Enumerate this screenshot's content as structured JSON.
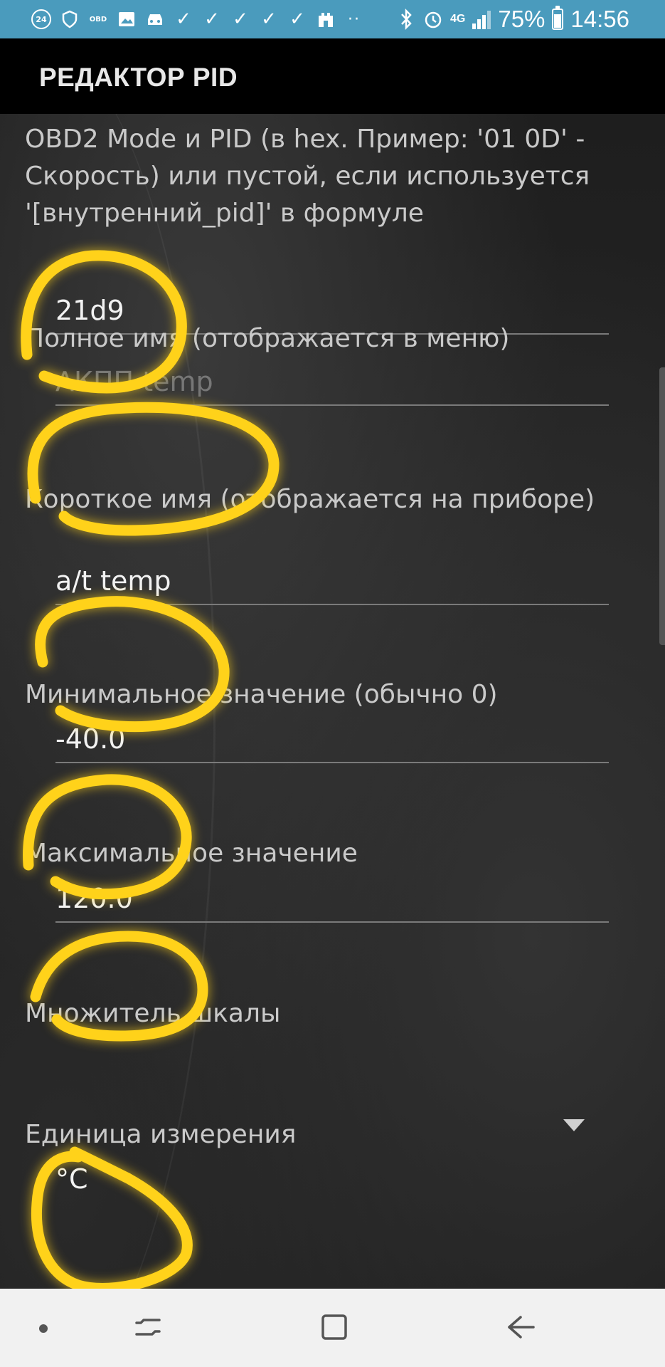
{
  "status_bar": {
    "notification_icons": [
      "calendar-24-icon",
      "shield-icon",
      "obd-icon",
      "gallery-icon",
      "car-icon",
      "check-icon",
      "check-icon",
      "check-icon",
      "check-icon",
      "check-icon",
      "castle-icon",
      "more-dots-icon"
    ],
    "calendar_day": "24",
    "obd_label": "OBD",
    "network_type": "4G",
    "battery_level": "75%",
    "battery_fraction": 0.75,
    "time": "14:56"
  },
  "app_bar": {
    "title": "РЕДАКТОР PID"
  },
  "form": {
    "mode_pid": {
      "label": "OBD2 Mode и PID (в hex. Пример: '01 0D' - Скорость) или пустой, если используется '[внутренний_pid]' в формуле",
      "value": "21d9"
    },
    "full_name": {
      "label": "Полное имя (отображается в меню)",
      "value": "АКПП temp"
    },
    "short_name": {
      "label": "Короткое имя (отображается на приборе)",
      "value": "a/t temp"
    },
    "min_value": {
      "label": "Минимальное значение (обычно 0)",
      "value": "-40.0"
    },
    "max_value": {
      "label": "Максимальное значение",
      "value": "120.0"
    },
    "scale_multiplier": {
      "label": "Множитель шкалы",
      "value": ""
    },
    "units": {
      "label": "Единица измерения",
      "value": "°C"
    }
  },
  "colors": {
    "status_bar": "#4a9bbd",
    "annotation": "#ffd21a"
  }
}
